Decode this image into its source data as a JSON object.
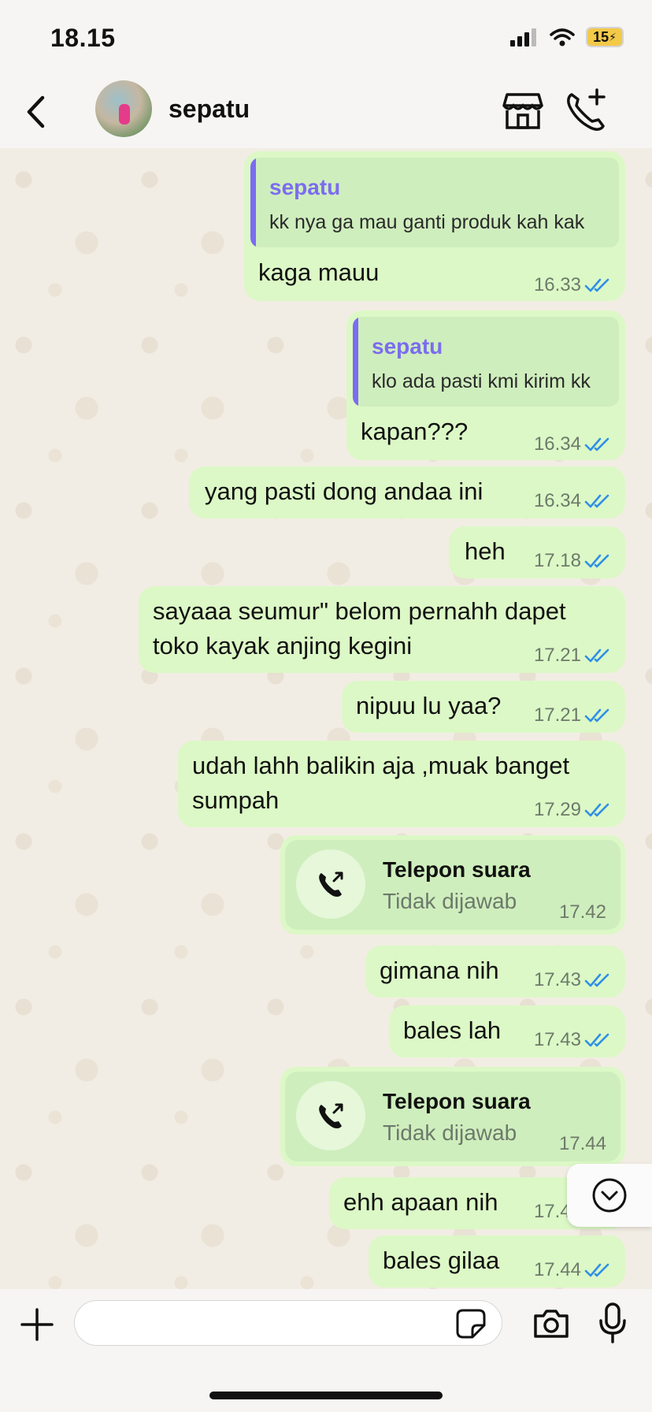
{
  "status_bar": {
    "time": "18.15",
    "battery": "15"
  },
  "header": {
    "contact_name": "sepatu"
  },
  "messages": [
    {
      "quote_author": "sepatu",
      "quote_text": "kk nya ga mau ganti produk kah kak",
      "text": "kaga mauu",
      "time": "16.33"
    },
    {
      "quote_author": "sepatu",
      "quote_text": "klo ada pasti kmi kirim kk",
      "text": "kapan???",
      "time": "16.34"
    },
    {
      "text": "yang pasti dong andaa ini",
      "time": "16.34"
    },
    {
      "text": "heh",
      "time": "17.18"
    },
    {
      "text": "sayaaa seumur\" belom pernahh dapet toko kayak anjing kegini",
      "time": "17.21"
    },
    {
      "text": "nipuu lu yaa?",
      "time": "17.21"
    },
    {
      "text": "udah lahh balikin aja ,muak banget sumpah",
      "time": "17.29"
    },
    {
      "call_title": "Telepon suara",
      "call_status": "Tidak dijawab",
      "time": "17.42"
    },
    {
      "text": "gimana nih",
      "time": "17.43"
    },
    {
      "text": "bales lah",
      "time": "17.43"
    },
    {
      "call_title": "Telepon suara",
      "call_status": "Tidak dijawab",
      "time": "17.44"
    },
    {
      "text": "ehh apaan nih",
      "time": "17.44"
    },
    {
      "text": "bales gilaa",
      "time": "17.44"
    }
  ],
  "input": {
    "placeholder": ""
  },
  "colors": {
    "bubble": "#dcf8c6",
    "quote_author": "#7b6cf0",
    "tick": "#2f8fe8",
    "battery": "#f3c948"
  },
  "icons": [
    "back-icon",
    "shop-icon",
    "add-call-icon",
    "missed-call-icon",
    "scroll-down-icon",
    "plus-icon",
    "sticker-icon",
    "camera-icon",
    "mic-icon"
  ]
}
